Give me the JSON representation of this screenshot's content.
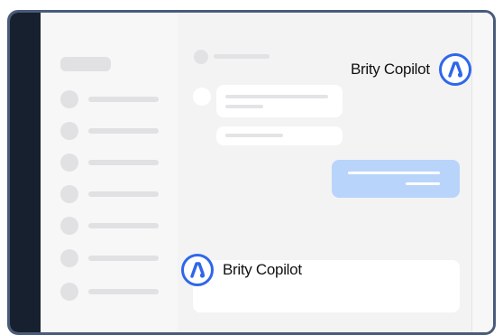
{
  "window": {
    "controls": [
      "_",
      "□",
      "×"
    ]
  },
  "sidebar": {
    "items": 7
  },
  "callouts": {
    "top_label": "Brity Copilot",
    "bottom_label": "Brity Copilot",
    "logo_icon": "brity-copilot-logo-icon"
  },
  "colors": {
    "brand_blue": "#2f67ea",
    "outgoing_bubble": "#b9d4fb",
    "dark_rail": "#17202e"
  }
}
